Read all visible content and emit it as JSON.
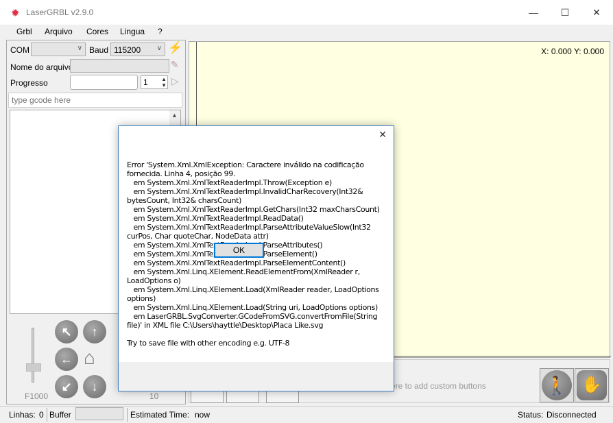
{
  "window": {
    "title": "LaserGRBL v2.9.0",
    "minimize": "—",
    "maximize": "☐",
    "close": "✕"
  },
  "menu": [
    "Grbl",
    "Arquivo",
    "Cores",
    "Lingua",
    "?"
  ],
  "connection": {
    "com_label": "COM",
    "com_value": "",
    "baud_label": "Baud",
    "baud_value": "115200"
  },
  "file": {
    "label": "Nome do arquivo",
    "value": ""
  },
  "progress": {
    "label": "Progresso",
    "copies": "1"
  },
  "gcode_input": {
    "placeholder": "type gcode here"
  },
  "jog": {
    "feed": "F1000",
    "step": "10"
  },
  "canvas": {
    "coords": "X: 0.000 Y: 0.000",
    "custom_hint": "ere to add custom buttons"
  },
  "dialog": {
    "message": "Error 'System.Xml.XmlException: Caractere inválido na codificação fornecida. Linha 4, posição 99.\n   em System.Xml.XmlTextReaderImpl.Throw(Exception e)\n   em System.Xml.XmlTextReaderImpl.InvalidCharRecovery(Int32& bytesCount, Int32& charsCount)\n   em System.Xml.XmlTextReaderImpl.GetChars(Int32 maxCharsCount)\n   em System.Xml.XmlTextReaderImpl.ReadData()\n   em System.Xml.XmlTextReaderImpl.ParseAttributeValueSlow(Int32 curPos, Char quoteChar, NodeData attr)\n   em System.Xml.XmlTextReaderImpl.ParseAttributes()\n   em System.Xml.XmlTextReaderImpl.ParseElement()\n   em System.Xml.XmlTextReaderImpl.ParseElementContent()\n   em System.Xml.Linq.XElement.ReadElementFrom(XmlReader r, LoadOptions o)\n   em System.Xml.Linq.XElement.Load(XmlReader reader, LoadOptions options)\n   em System.Xml.Linq.XElement.Load(String uri, LoadOptions options)\n   em LaserGRBL.SvgConverter.GCodeFromSVG.convertFromFile(String file)' in XML file C:\\Users\\hayttle\\Desktop\\Placa Like.svg\n\nTry to save file with other encoding e.g. UTF-8",
    "ok": "OK",
    "close": "✕"
  },
  "status": {
    "lines_label": "Linhas:",
    "lines_value": "0",
    "buffer_label": "Buffer",
    "est_label": "Estimated Time:",
    "est_value": "now",
    "status_label": "Status:",
    "status_value": "Disconnected"
  }
}
